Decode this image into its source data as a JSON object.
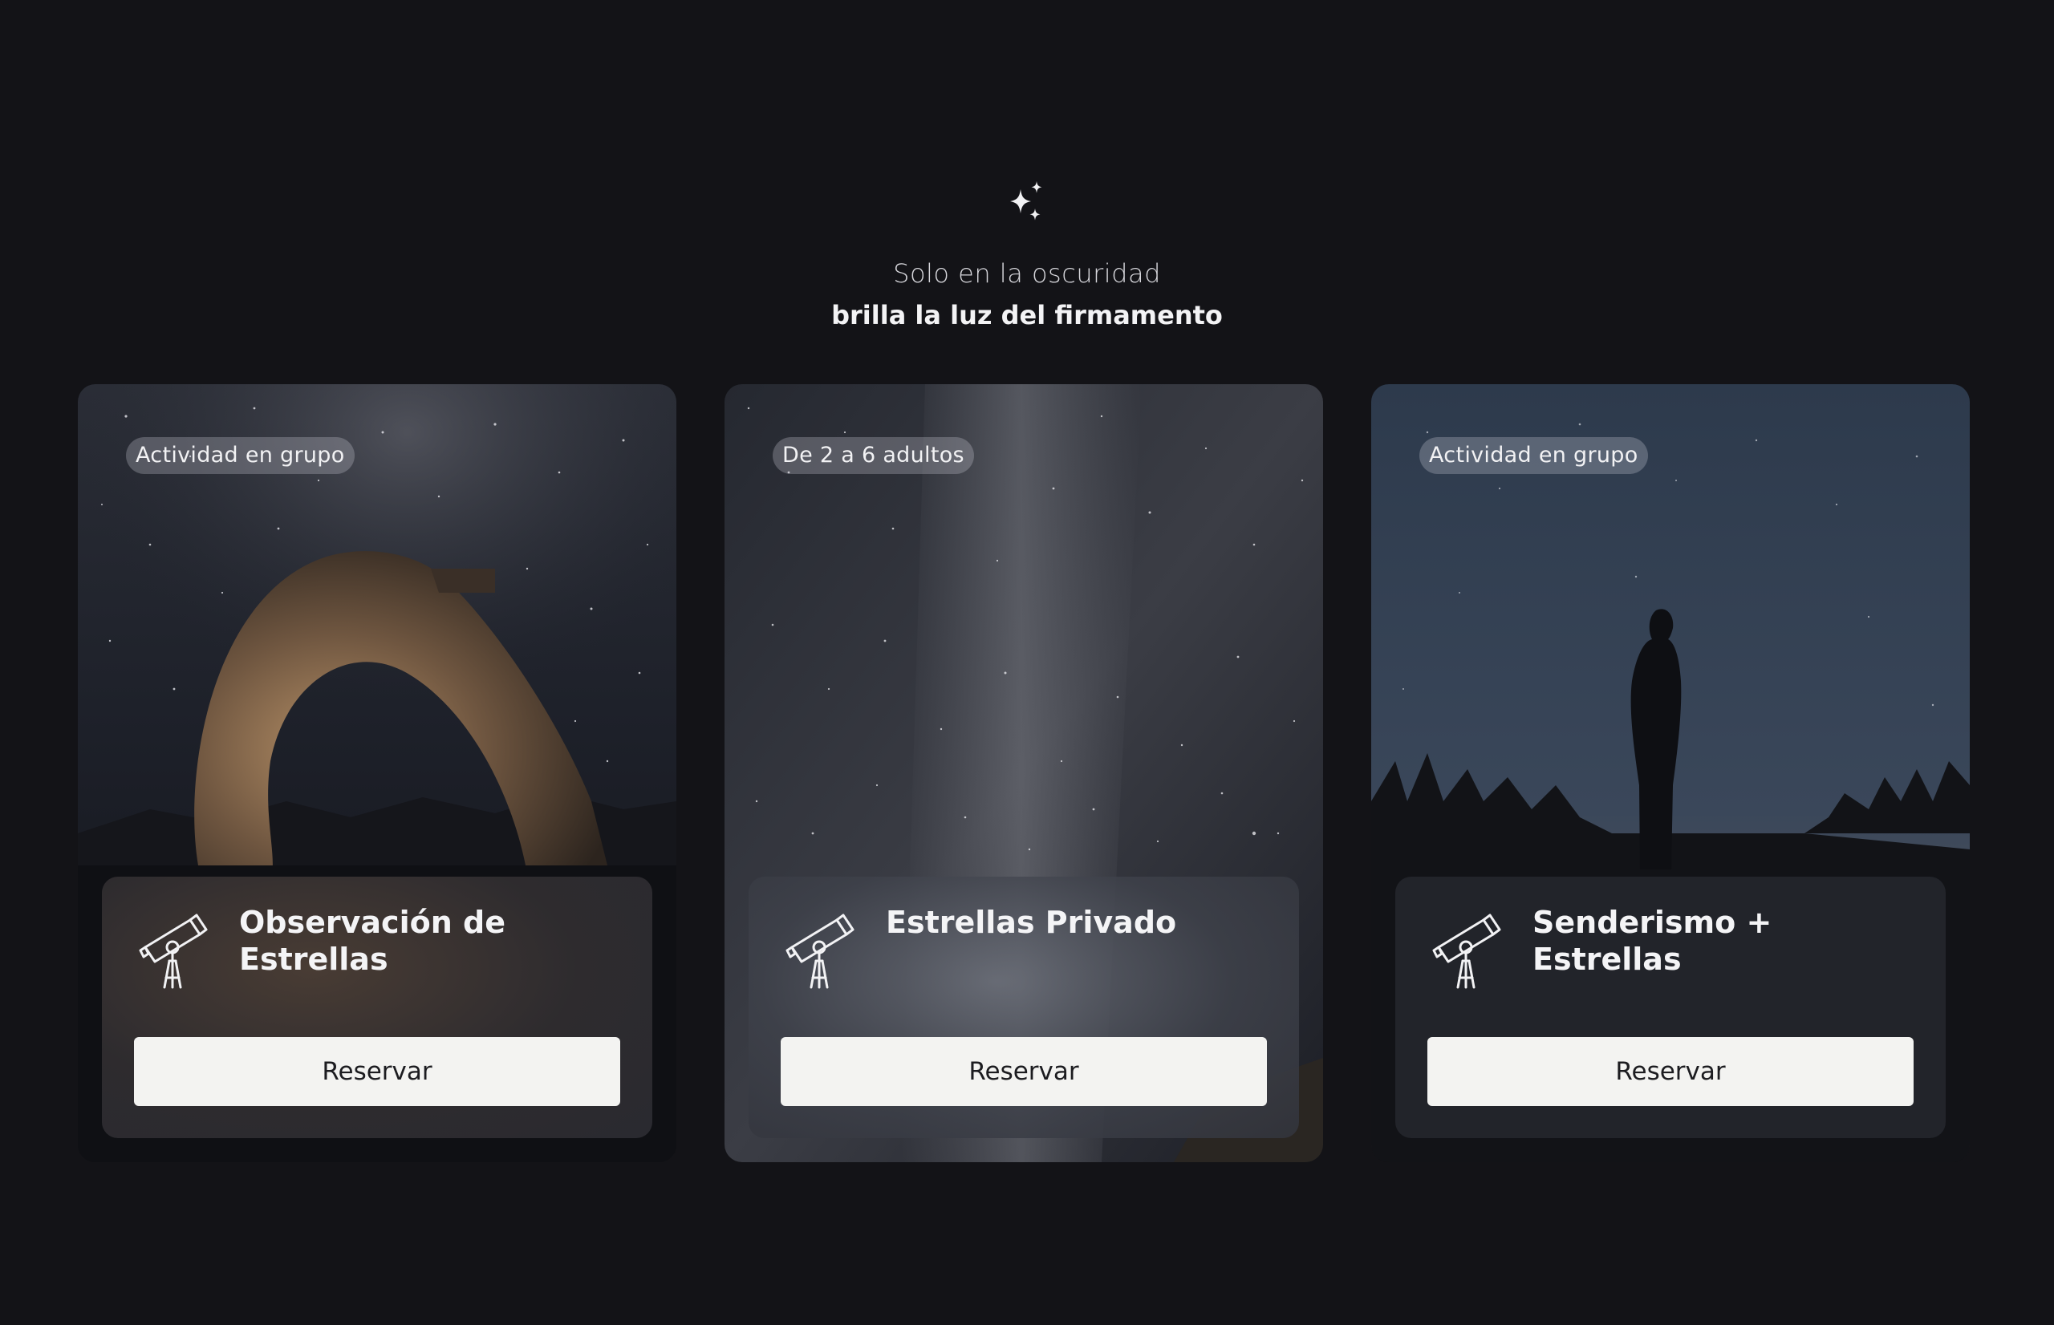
{
  "hero": {
    "icon": "sparkles-icon",
    "line1": "Solo en la oscuridad",
    "line2": "brilla la luz del firmamento"
  },
  "cards": [
    {
      "badge": "Actividad en grupo",
      "title": "Observación de Estrellas",
      "icon": "telescope-icon",
      "button": "Reservar",
      "image": "rock-arch-under-milky-way"
    },
    {
      "badge": "De 2 a 6 adultos",
      "title": "Estrellas Privado",
      "icon": "telescope-icon",
      "button": "Reservar",
      "image": "starry-night-sky"
    },
    {
      "badge": "Actividad en grupo",
      "title": "Senderismo + Estrellas",
      "icon": "telescope-icon",
      "button": "Reservar",
      "image": "person-silhouette-stargazing"
    }
  ],
  "colors": {
    "background": "#131317",
    "button": "#f3f3f1",
    "button_text": "#1c1c20"
  }
}
